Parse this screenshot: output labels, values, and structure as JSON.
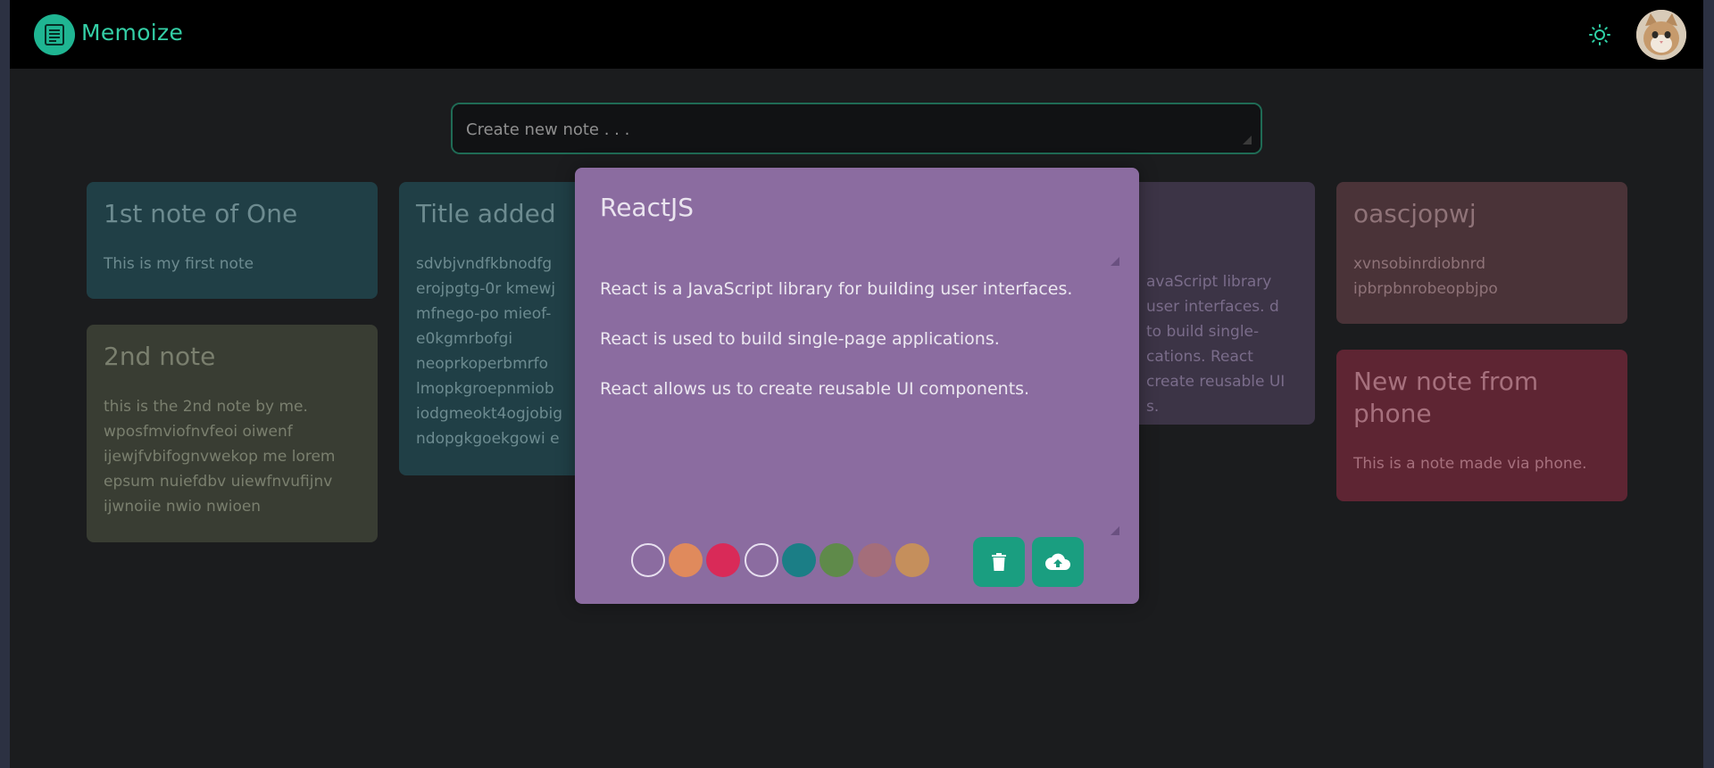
{
  "app": {
    "name": "Memoize"
  },
  "header": {
    "theme_icon": "sun-icon",
    "avatar": "cat-avatar"
  },
  "create": {
    "placeholder": "Create new note . . ."
  },
  "notes": [
    {
      "title": "1st note of One",
      "body": "This is my first note",
      "color": "#2a6470"
    },
    {
      "title": "2nd note",
      "body": "this is the 2nd note by me. wposfmviofnvfeoi oiwenf ijewjfvbifognvwekop me lorem epsum nuiefdbv uiewfnvufijnv ijwnoiie nwio nwioen",
      "color": "#545c45"
    },
    {
      "title": "Title added",
      "body": "sdvbjvndfkbnodfg erojpgtg-0r kmewj mfnego-po mieof- e0kgmrbofgi neoprkoperbmrfo lmopkgroepnmiob iodgmeokt4ogjobig ndopgkgoekgowi e",
      "color": "#2a6470"
    },
    {
      "title": "",
      "body": "avaScript library user interfaces. d to build single- cations. React create reusable UI s.",
      "color": "#5b4b74"
    },
    {
      "title": "oascjopwj",
      "body": "xvnsobinrdiobnrd ipbrpbnrobeopbjpo",
      "color": "#6e4450"
    },
    {
      "title": "New note from phone",
      "body": "This is a note made via phone.",
      "color": "#8c2b46"
    }
  ],
  "modal": {
    "title": "ReactJS",
    "paragraphs": [
      "React is a JavaScript library for building user interfaces.",
      "React is used to build single-page applications.",
      "React allows us to create reusable UI components."
    ],
    "bg_color": "#8b6ca0",
    "swatches": [
      "#8b6ca0",
      "#e08a5c",
      "#d92a58",
      "#8b6ca0",
      "#1b7e86",
      "#5f8a4a",
      "#a46e7a",
      "#c58f5c"
    ],
    "delete_icon": "trash-icon",
    "save_icon": "cloud-upload-icon"
  }
}
